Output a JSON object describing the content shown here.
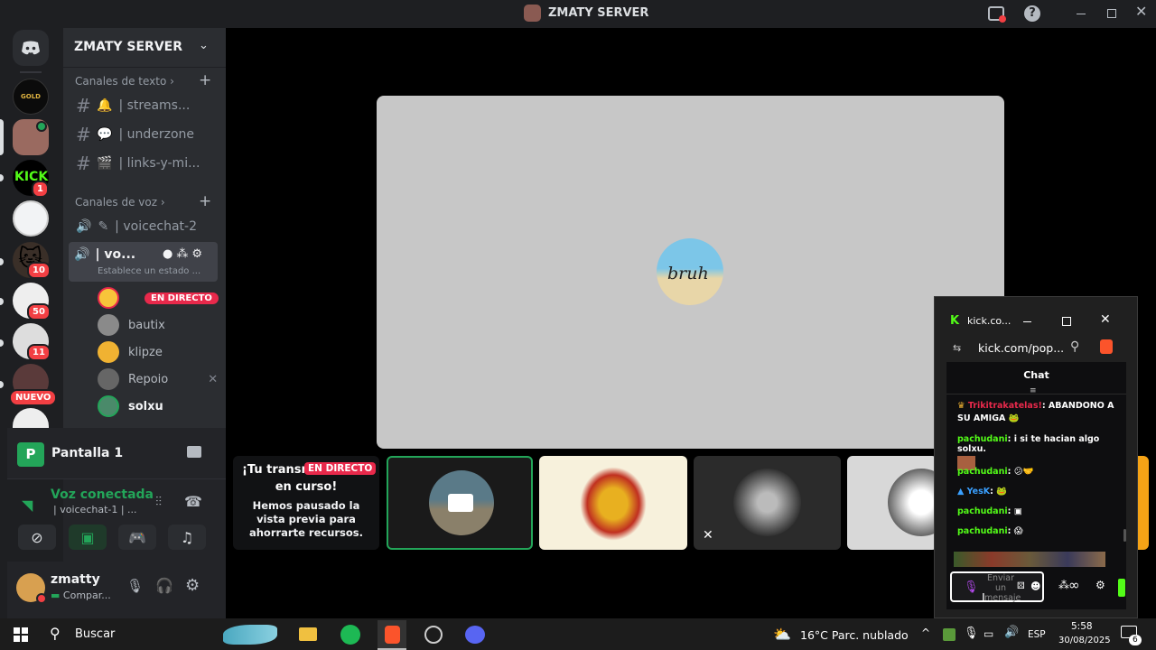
{
  "window": {
    "title": "ZMATY SERVER"
  },
  "servers": {
    "badges": [
      "1",
      "10",
      "50",
      "11"
    ],
    "new_label": "NUEVO"
  },
  "sidebar": {
    "server_name": "ZMATY SERVER",
    "text_category": "Canales de texto",
    "text_channels": [
      {
        "emoji": "🔔",
        "name": "| streams..."
      },
      {
        "emoji": "💬",
        "name": "| underzone"
      },
      {
        "emoji": "🎬",
        "name": "| links-y-mi..."
      }
    ],
    "voice_category": "Canales de voz",
    "voice_channels": [
      {
        "name": "| voicechat-2"
      },
      {
        "name": "| vo...",
        "status": "Establece un estado ..."
      }
    ],
    "voice_users": [
      {
        "name": "",
        "live": "EN DIRECTO"
      },
      {
        "name": "bautix"
      },
      {
        "name": "klipze"
      },
      {
        "name": "Repoio"
      },
      {
        "name": "solxu"
      }
    ]
  },
  "panel": {
    "screen_label": "Pantalla 1",
    "voice_status": "Voz conectada",
    "voice_channel": "| voicechat-1 | ...",
    "username": "zmatty",
    "user_status": "Compar..."
  },
  "stage": {
    "main_avatar_text": "bruh",
    "preview_title": "¡Tu transmisión está en curso!",
    "preview_title_a": "¡Tu transm",
    "preview_title_b": "en curso!",
    "live_badge": "EN DIRECTO",
    "preview_body": "Hemos pausado la vista previa para ahorrarte recursos."
  },
  "kick": {
    "tab_title": "kick.co...",
    "url": "kick.com/pop...",
    "chat_title": "Chat",
    "messages": [
      {
        "user": "Trikitrakatelas!",
        "text": ": ABANDONO A SU AMIGA"
      },
      {
        "user": "pachudani",
        "text": ": i si te hacian algo solxu."
      },
      {
        "user": "pachudani",
        "text": ":"
      },
      {
        "user": "YesK",
        "text": ":"
      },
      {
        "user": "pachudani",
        "text": ":"
      },
      {
        "user": "pachudani",
        "text": ":"
      }
    ],
    "input_placeholder": "Enviar un mensaje",
    "infinity": "∞"
  },
  "taskbar": {
    "search": "Buscar",
    "weather": "16°C  Parc. nublado",
    "lang": "ESP",
    "time": "5:58",
    "date": "30/08/2025",
    "notif_count": "6"
  },
  "colors": {
    "accent_green": "#23a559",
    "live_red": "#e8294b",
    "kick_green": "#53fc18"
  }
}
